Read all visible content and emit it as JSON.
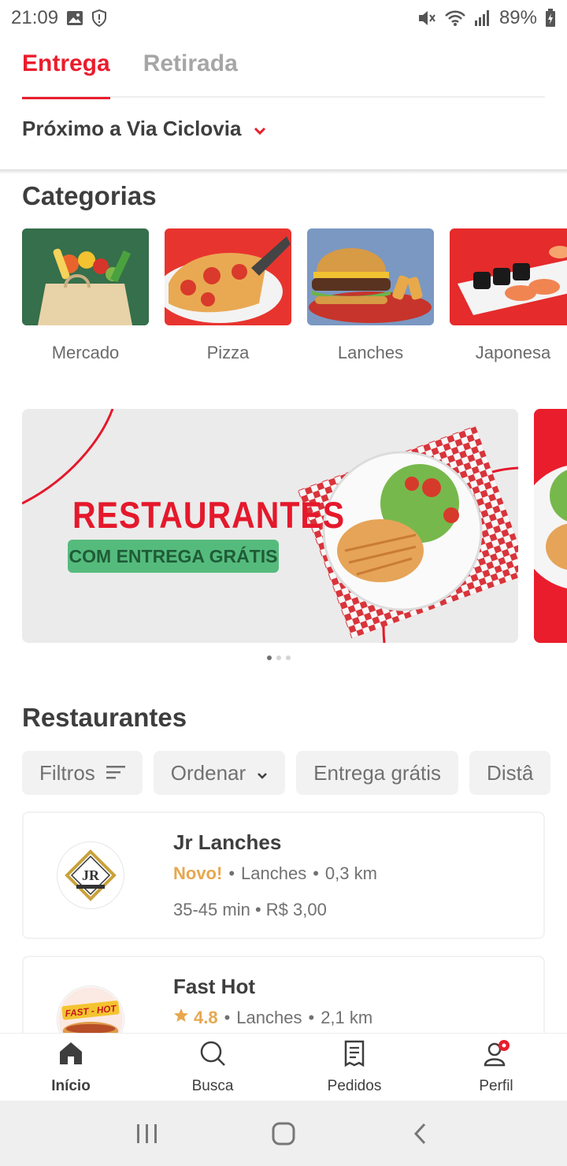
{
  "status_bar": {
    "time": "21:09",
    "battery": "89%"
  },
  "tabs": [
    {
      "label": "Entrega",
      "active": true
    },
    {
      "label": "Retirada",
      "active": false
    }
  ],
  "address": {
    "label": "Próximo a Via Ciclovia"
  },
  "categories": {
    "title": "Categorias",
    "items": [
      {
        "label": "Mercado"
      },
      {
        "label": "Pizza"
      },
      {
        "label": "Lanches"
      },
      {
        "label": "Japonesa"
      }
    ]
  },
  "banner": {
    "title": "RESTAURANTES",
    "pill": "COM ENTREGA GRÁTIS",
    "dots_total": 3,
    "dots_active": 1
  },
  "restaurants": {
    "title": "Restaurantes",
    "filters": [
      {
        "label": "Filtros",
        "icon": "filter-lines-icon"
      },
      {
        "label": "Ordenar",
        "icon": "chevron-down-icon"
      },
      {
        "label": "Entrega grátis"
      },
      {
        "label": "Distâ"
      }
    ],
    "items": [
      {
        "name": "Jr Lanches",
        "badge": "Novo!",
        "category": "Lanches",
        "distance": "0,3 km",
        "meta": "35-45 min • R$ 3,00",
        "logo_text": "JR"
      },
      {
        "name": "Fast Hot",
        "rating": "4.8",
        "category": "Lanches",
        "distance": "2,1 km",
        "logo_text": "FAST - HOT"
      }
    ]
  },
  "bottom_nav": [
    {
      "label": "Início",
      "icon": "home-icon",
      "active": true
    },
    {
      "label": "Busca",
      "icon": "search-icon",
      "active": false
    },
    {
      "label": "Pedidos",
      "icon": "receipt-icon",
      "active": false
    },
    {
      "label": "Perfil",
      "icon": "profile-icon",
      "active": false
    }
  ],
  "colors": {
    "brand": "#ea1d2c",
    "accent": "#e7a74e",
    "green": "#55bb7d",
    "text": "#3f3e3e",
    "muted": "#717171"
  }
}
